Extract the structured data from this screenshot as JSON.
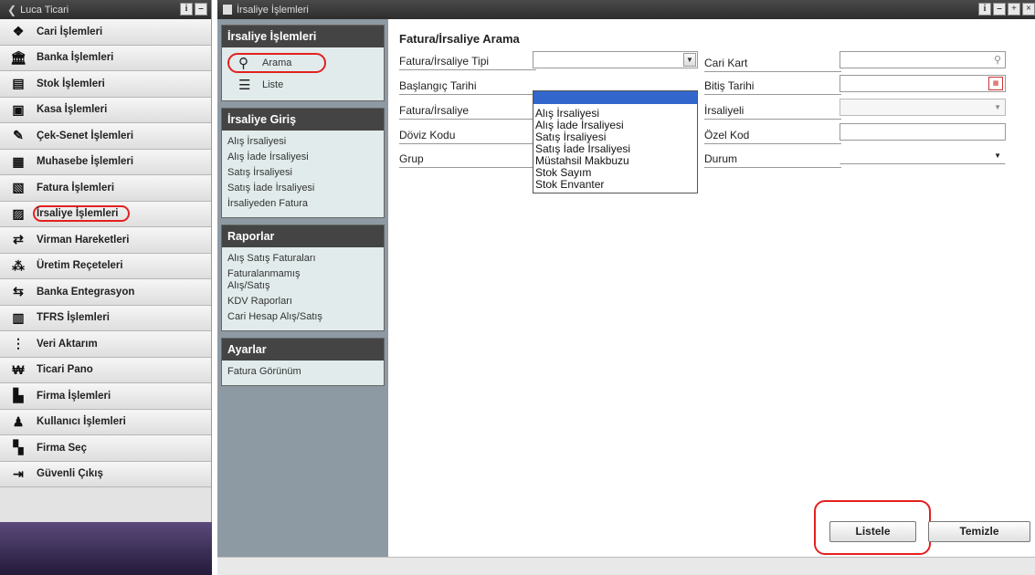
{
  "left_nav": {
    "user_label": "Luca Ticari",
    "items": [
      {
        "label": "Cari İşlemleri",
        "icon": "handshake-icon"
      },
      {
        "label": "Banka İşlemleri",
        "icon": "bank-icon"
      },
      {
        "label": "Stok İşlemleri",
        "icon": "stock-icon"
      },
      {
        "label": "Kasa İşlemleri",
        "icon": "safe-icon"
      },
      {
        "label": "Çek-Senet İşlemleri",
        "icon": "check-icon"
      },
      {
        "label": "Muhasebe İşlemleri",
        "icon": "calculator-icon"
      },
      {
        "label": "Fatura İşlemleri",
        "icon": "invoice-icon"
      },
      {
        "label": "İrsaliye İşlemleri",
        "icon": "waybill-icon"
      },
      {
        "label": "Virman Hareketleri",
        "icon": "transfer-icon"
      },
      {
        "label": "Üretim Reçeteleri",
        "icon": "production-icon"
      },
      {
        "label": "Banka Entegrasyon",
        "icon": "integration-icon"
      },
      {
        "label": "TFRS İşlemleri",
        "icon": "tfrs-icon"
      },
      {
        "label": "Veri Aktarım",
        "icon": "data-transfer-icon"
      },
      {
        "label": "Ticari Pano",
        "icon": "dashboard-icon"
      },
      {
        "label": "Firma İşlemleri",
        "icon": "company-icon"
      },
      {
        "label": "Kullanıcı İşlemleri",
        "icon": "user-icon"
      },
      {
        "label": "Firma Seç",
        "icon": "company-select-icon"
      },
      {
        "label": "Güvenli Çıkış",
        "icon": "logout-icon"
      }
    ]
  },
  "window": {
    "title": "İrsaliye İşlemleri"
  },
  "submenu": {
    "panels": [
      {
        "title": "İrsaliye İşlemleri",
        "buttons": [
          {
            "label": "Arama",
            "icon": "search-icon"
          },
          {
            "label": "Liste",
            "icon": "list-icon"
          }
        ]
      },
      {
        "title": "İrsaliye Giriş",
        "links": [
          "Alış İrsaliyesi",
          "Alış İade İrsaliyesi",
          "Satış İrsaliyesi",
          "Satış İade İrsaliyesi",
          "İrsaliyeden Fatura"
        ]
      },
      {
        "title": "Raporlar",
        "links": [
          "Alış Satış Faturaları",
          "Faturalanmamış Alış/Satış",
          "KDV Raporları",
          "Cari Hesap Alış/Satış"
        ]
      },
      {
        "title": "Ayarlar",
        "links": [
          "Fatura Görünüm"
        ]
      }
    ]
  },
  "form": {
    "title": "Fatura/İrsaliye Arama",
    "labels": {
      "type": "Fatura/İrsaliye Tipi",
      "start_date": "Başlangıç Tarihi",
      "invoice_waybill": "Fatura/İrsaliye",
      "currency": "Döviz Kodu",
      "group": "Grup",
      "account": "Cari Kart",
      "end_date": "Bitiş Tarihi",
      "waybilled": "İrsaliyeli",
      "special_code": "Özel Kod",
      "status": "Durum"
    },
    "type_dropdown": {
      "selected": "",
      "options": [
        "",
        "Alış İrsaliyesi",
        "Alış İade İrsaliyesi",
        "Satış İrsaliyesi",
        "Satış İade İrsaliyesi",
        "Müstahsil Makbuzu",
        "Stok Sayım",
        "Stok Envanter"
      ]
    },
    "buttons": {
      "list": "Listele",
      "clear": "Temizle"
    }
  },
  "colors": {
    "highlight_circle": "#e32020",
    "header_dark": "#444444",
    "selected_option": "#3366cc"
  }
}
